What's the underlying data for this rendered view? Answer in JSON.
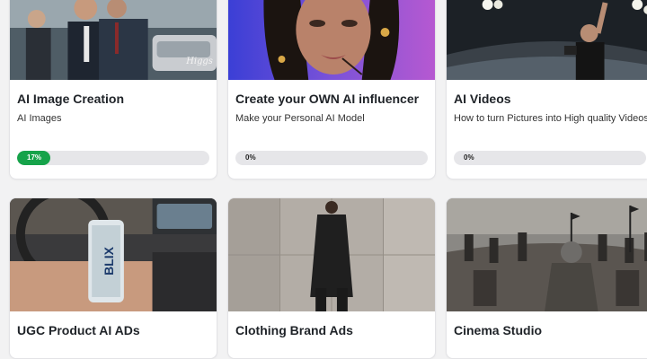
{
  "courses": [
    {
      "title": "AI Image Creation",
      "subtitle": "AI Images",
      "progress_label": "17%",
      "progress": 0.17,
      "image_icon": "vintage-street-photo-image",
      "image_text": "Higgs"
    },
    {
      "title": "Create your OWN AI influencer",
      "subtitle": "Make your Personal AI Model",
      "progress_label": "0%",
      "progress": 0,
      "image_icon": "portrait-woman-image"
    },
    {
      "title": "AI Videos",
      "subtitle": "How to turn Pictures into High quality Videos",
      "progress_label": "0%",
      "progress": 0,
      "image_icon": "stadium-photographer-image"
    },
    {
      "title": "UGC Product AI ADs",
      "image_icon": "energy-can-car-image",
      "image_text": "BLIX"
    },
    {
      "title": "Clothing Brand Ads",
      "image_icon": "fashion-model-concrete-wall-image"
    },
    {
      "title": "Cinema Studio",
      "image_icon": "medieval-army-image"
    }
  ],
  "colors": {
    "progress_fill": "#16a34a",
    "progress_track": "#e6e6e9",
    "page_background": "#f2f2f3"
  }
}
